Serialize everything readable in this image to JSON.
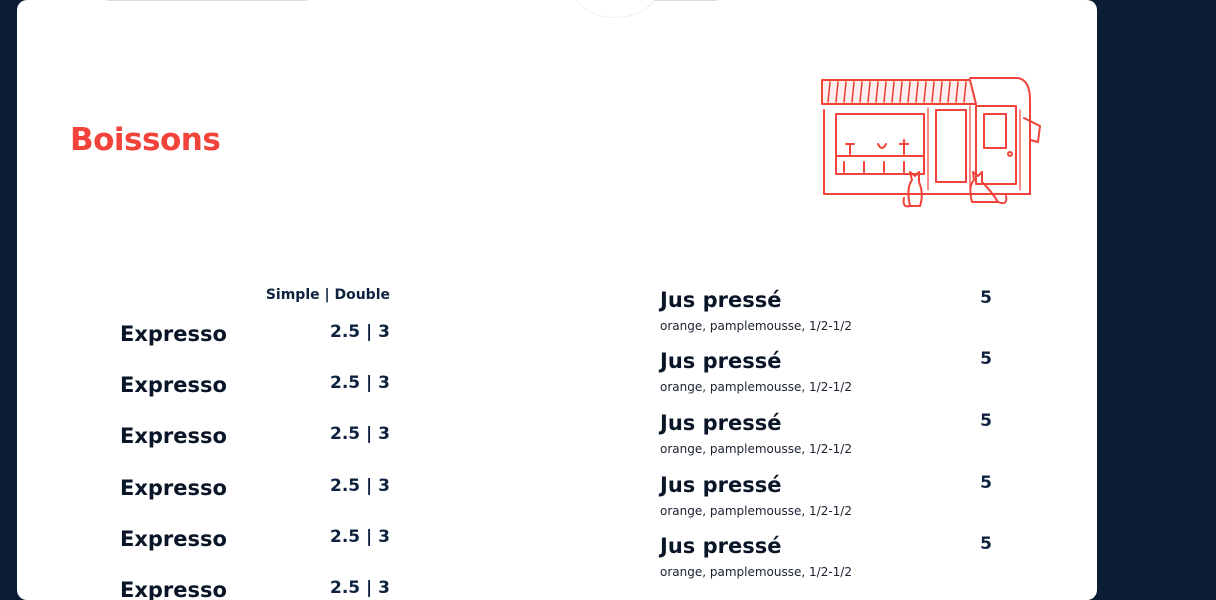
{
  "section": {
    "title": "Boissons"
  },
  "coffee": {
    "column_header": "Simple | Double",
    "items": [
      {
        "name": "Expresso",
        "price": "2.5 | 3"
      },
      {
        "name": "Expresso",
        "price": "2.5 | 3"
      },
      {
        "name": "Expresso",
        "price": "2.5 | 3"
      },
      {
        "name": "Expresso",
        "price": "2.5 | 3"
      },
      {
        "name": "Expresso",
        "price": "2.5 | 3"
      },
      {
        "name": "Expresso",
        "price": "2.5 | 3"
      }
    ]
  },
  "juices": {
    "items": [
      {
        "name": "Jus pressé",
        "price": "5",
        "description": "orange, pamplemousse, 1/2-1/2"
      },
      {
        "name": "Jus pressé",
        "price": "5",
        "description": "orange, pamplemousse, 1/2-1/2"
      },
      {
        "name": "Jus pressé",
        "price": "5",
        "description": "orange, pamplemousse, 1/2-1/2"
      },
      {
        "name": "Jus pressé",
        "price": "5",
        "description": "orange, pamplemousse, 1/2-1/2"
      },
      {
        "name": "Jus pressé",
        "price": "5",
        "description": "orange, pamplemousse, 1/2-1/2"
      }
    ]
  },
  "colors": {
    "background": "#0b1d34",
    "accent": "#f2433a",
    "text": "#0a1628"
  },
  "illustration": {
    "icon": "cafe-storefront-illustration"
  }
}
